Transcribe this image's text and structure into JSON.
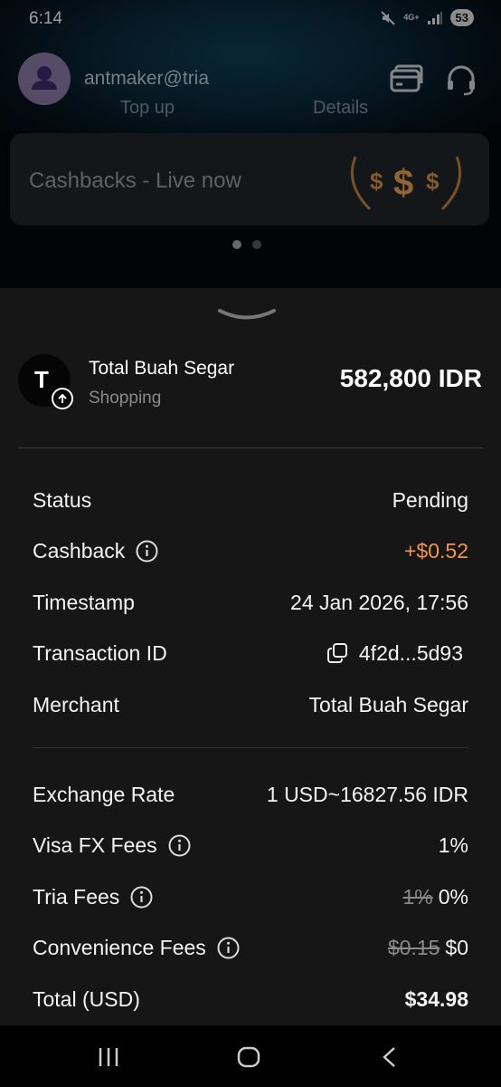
{
  "status_bar": {
    "time": "6:14",
    "network": "4G+",
    "battery": "53"
  },
  "background": {
    "username": "antmaker@tria",
    "tabs": [
      "Top up",
      "Details"
    ],
    "banner_text": "Cashbacks - Live now"
  },
  "transaction": {
    "merchant_initial": "T",
    "merchant_name": "Total Buah Segar",
    "category": "Shopping",
    "amount": "582,800 IDR"
  },
  "details": {
    "status_label": "Status",
    "status_value": "Pending",
    "cashback_label": "Cashback",
    "cashback_value": "+$0.52",
    "timestamp_label": "Timestamp",
    "timestamp_value": "24 Jan 2026, 17:56",
    "txid_label": "Transaction ID",
    "txid_value": "4f2d...5d93",
    "merchant_label": "Merchant",
    "merchant_value": "Total Buah Segar"
  },
  "fees": {
    "rate_label": "Exchange Rate",
    "rate_value": "1 USD~16827.56 IDR",
    "visa_label": "Visa FX Fees",
    "visa_value": "1%",
    "tria_label": "Tria Fees",
    "tria_old": "1%",
    "tria_value": "0%",
    "conv_label": "Convenience Fees",
    "conv_old": "$0.15",
    "conv_value": "$0",
    "total_label": "Total (USD)",
    "total_value": "$34.98"
  },
  "colors": {
    "accent_orange": "#f2954a",
    "sheet_bg": "#161616"
  },
  "icons": {
    "header": [
      "cards-icon",
      "headset-icon"
    ],
    "info": "info-icon",
    "copy": "copy-icon",
    "nav": [
      "recents-icon",
      "home-icon",
      "back-icon"
    ]
  }
}
